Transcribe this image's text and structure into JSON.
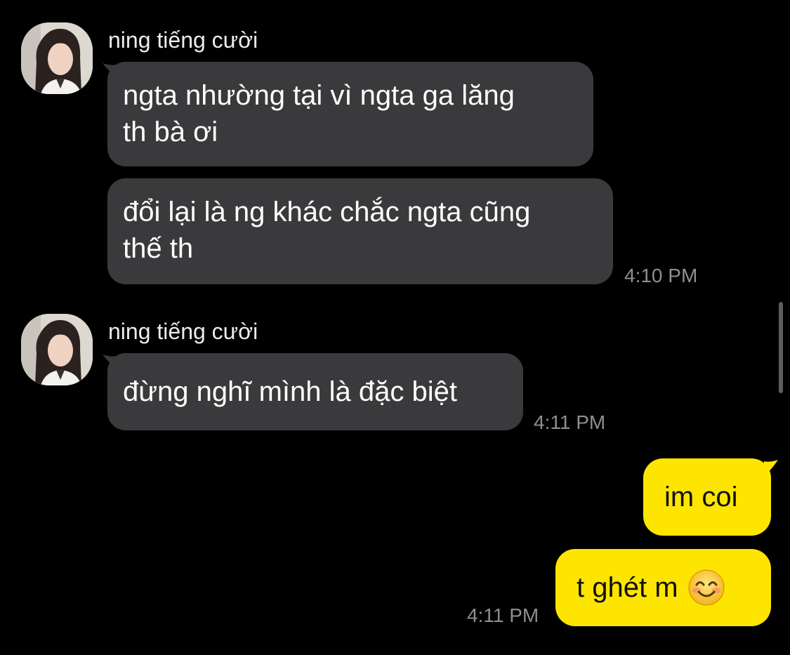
{
  "groups": [
    {
      "sender": "ning tiếng cười",
      "messages": [
        {
          "lines": [
            "ngta nhường tại vì ngta ga lăng",
            "th bà ơi"
          ]
        },
        {
          "lines": [
            "đổi lại là ng khác chắc ngta cũng",
            "thế th"
          ]
        }
      ],
      "time": "4:10 PM"
    },
    {
      "sender": "ning tiếng cười",
      "messages": [
        {
          "lines": [
            "đừng nghĩ mình là đặc biệt"
          ]
        }
      ],
      "time": "4:11 PM"
    }
  ],
  "outgoing": {
    "messages": [
      {
        "text": "im coi"
      },
      {
        "text": "t ghét m",
        "emoji": "smiling-face-emoji"
      }
    ],
    "time": "4:11 PM"
  },
  "colors": {
    "background": "#000000",
    "incoming_bubble": "#3a3a3c",
    "outgoing_bubble": "#fee500",
    "timestamp": "#8e8e93"
  }
}
